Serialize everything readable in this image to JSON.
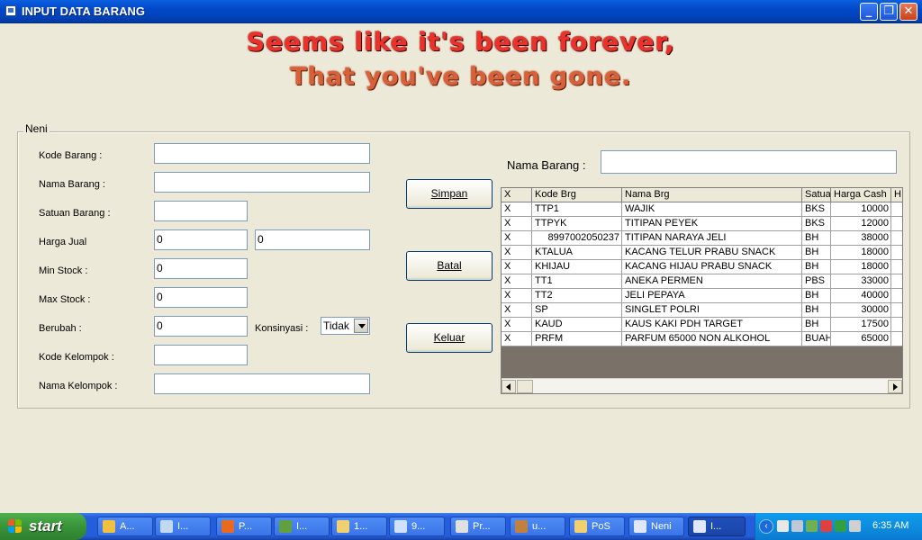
{
  "window": {
    "title": "INPUT DATA BARANG"
  },
  "heading": {
    "line1": "Seems like it's been forever,",
    "line2": "That you've been gone."
  },
  "group": {
    "legend": "Neni"
  },
  "form": {
    "kode_barang_label": "Kode Barang :",
    "nama_barang_label": "Nama Barang :",
    "satuan_barang_label": "Satuan Barang :",
    "harga_jual_label": "Harga Jual",
    "min_stock_label": "Min Stock :",
    "max_stock_label": "Max Stock :",
    "berubah_label": "Berubah :",
    "konsinyasi_label": "Konsinyasi :",
    "kode_kelompok_label": "Kode Kelompok :",
    "nama_kelompok_label": "Nama Kelompok :",
    "kode_barang_value": "",
    "nama_barang_value": "",
    "satuan_barang_value": "",
    "harga_jual_1_value": "0",
    "harga_jual_2_value": "0",
    "min_stock_value": "0",
    "max_stock_value": "0",
    "berubah_value": "0",
    "konsinyasi_value": "Tidak",
    "kode_kelompok_value": "",
    "nama_kelompok_value": ""
  },
  "buttons": {
    "simpan": "Simpan",
    "batal": "Batal",
    "keluar": "Keluar"
  },
  "search": {
    "label": "Nama Barang :",
    "value": ""
  },
  "grid": {
    "columns": [
      "X",
      "Kode Brg",
      "Nama Brg",
      "Satuan",
      "Harga Cash",
      "H"
    ],
    "rows": [
      [
        "X",
        "TTP1",
        "WAJIK",
        "BKS",
        "10000",
        ""
      ],
      [
        "X",
        "TTPYK",
        "TITIPAN PEYEK",
        "BKS",
        "12000",
        ""
      ],
      [
        "X",
        "8997002050237",
        "TITIPAN NARAYA JELI",
        "BH",
        "38000",
        ""
      ],
      [
        "X",
        "KTALUA",
        "KACANG TELUR PRABU SNACK",
        "BH",
        "18000",
        ""
      ],
      [
        "X",
        "KHIJAU",
        "KACANG HIJAU PRABU SNACK",
        "BH",
        "18000",
        ""
      ],
      [
        "X",
        "TT1",
        "ANEKA PERMEN",
        "PBS",
        "33000",
        ""
      ],
      [
        "X",
        "TT2",
        "JELI PEPAYA",
        "BH",
        "40000",
        ""
      ],
      [
        "X",
        "SP",
        "SINGLET POLRI",
        "BH",
        "30000",
        ""
      ],
      [
        "X",
        "KAUD",
        "KAUS KAKI PDH TARGET",
        "BH",
        "17500",
        ""
      ],
      [
        "X",
        "PRFM",
        "PARFUM 65000 NON ALKOHOL",
        "BUAH",
        "65000",
        ""
      ]
    ]
  },
  "taskbar": {
    "start_label": "start",
    "items": [
      {
        "label": "A...",
        "icon": "app-icon",
        "color": "#f0c040"
      },
      {
        "label": "I...",
        "icon": "browser-icon",
        "color": "#c0d8f0"
      },
      {
        "label": "P...",
        "icon": "firefox-icon",
        "color": "#e86a20"
      },
      {
        "label": "I...",
        "icon": "network-icon",
        "color": "#60a040"
      },
      {
        "label": "1...",
        "icon": "document-icon",
        "color": "#f0d070"
      },
      {
        "label": "9...",
        "icon": "chat-icon",
        "color": "#d0e0ff"
      },
      {
        "label": "Pr...",
        "icon": "tool-icon",
        "color": "#e0e0e0"
      },
      {
        "label": "u...",
        "icon": "game-icon",
        "color": "#c08040"
      },
      {
        "label": "PoS",
        "icon": "folder-icon",
        "color": "#f0d070"
      },
      {
        "label": "Neni",
        "icon": "window-icon",
        "color": "#e0e8f8"
      },
      {
        "label": "I...",
        "icon": "window-icon",
        "color": "#e0e8f8"
      }
    ],
    "clock": "6:35 AM"
  }
}
